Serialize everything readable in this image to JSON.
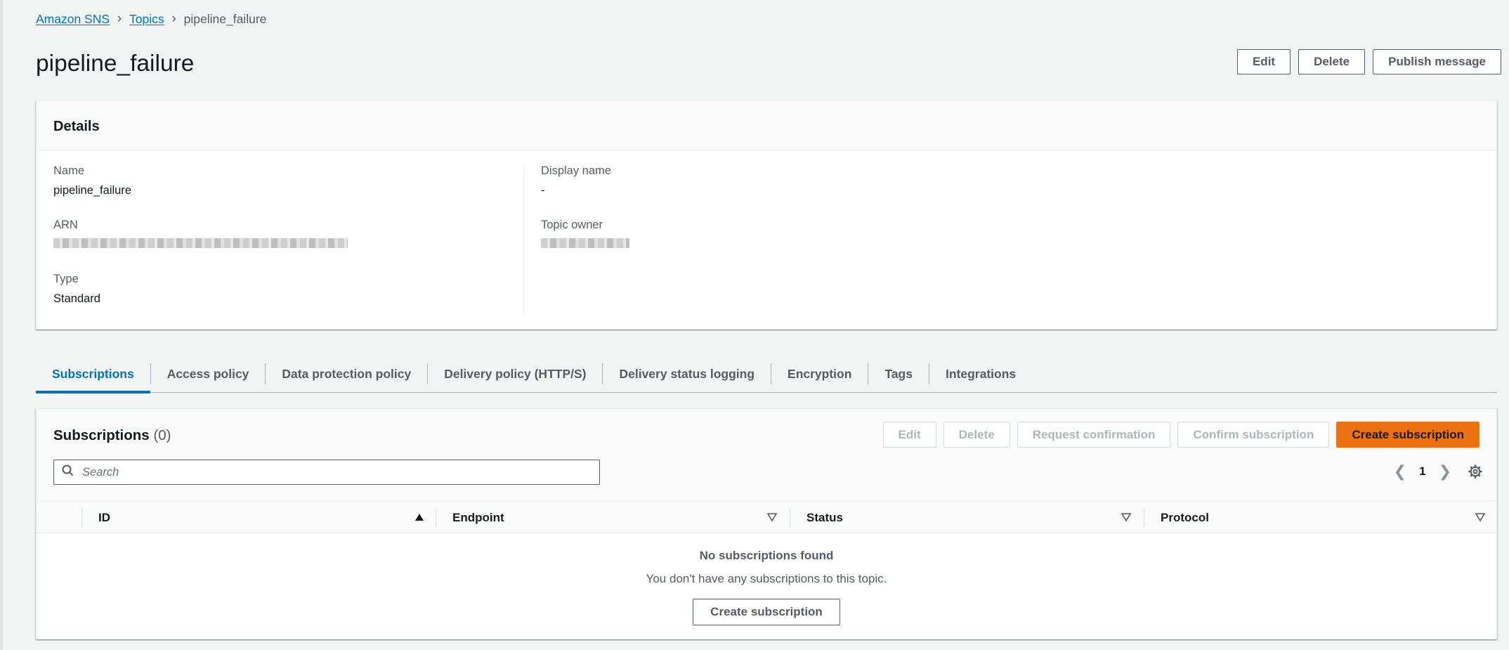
{
  "breadcrumb": {
    "items": [
      "Amazon SNS",
      "Topics"
    ],
    "current": "pipeline_failure"
  },
  "page": {
    "title": "pipeline_failure",
    "buttons": {
      "edit": "Edit",
      "delete": "Delete",
      "publish": "Publish message"
    }
  },
  "details": {
    "heading": "Details",
    "name_label": "Name",
    "name_value": "pipeline_failure",
    "arn_label": "ARN",
    "type_label": "Type",
    "type_value": "Standard",
    "display_name_label": "Display name",
    "display_name_value": "-",
    "topic_owner_label": "Topic owner"
  },
  "tabs": [
    "Subscriptions",
    "Access policy",
    "Data protection policy",
    "Delivery policy (HTTP/S)",
    "Delivery status logging",
    "Encryption",
    "Tags",
    "Integrations"
  ],
  "subscriptions": {
    "title": "Subscriptions",
    "count": "(0)",
    "buttons": {
      "edit": "Edit",
      "delete": "Delete",
      "request_confirmation": "Request confirmation",
      "confirm_subscription": "Confirm subscription",
      "create_subscription": "Create subscription"
    },
    "search_placeholder": "Search",
    "page_number": "1",
    "columns": [
      "ID",
      "Endpoint",
      "Status",
      "Protocol"
    ],
    "empty_title": "No subscriptions found",
    "empty_desc": "You don't have any subscriptions to this topic.",
    "empty_button": "Create subscription"
  },
  "colors": {
    "link": "#0073bb",
    "primary_button": "#ec7211",
    "background": "#f2f3f3"
  }
}
